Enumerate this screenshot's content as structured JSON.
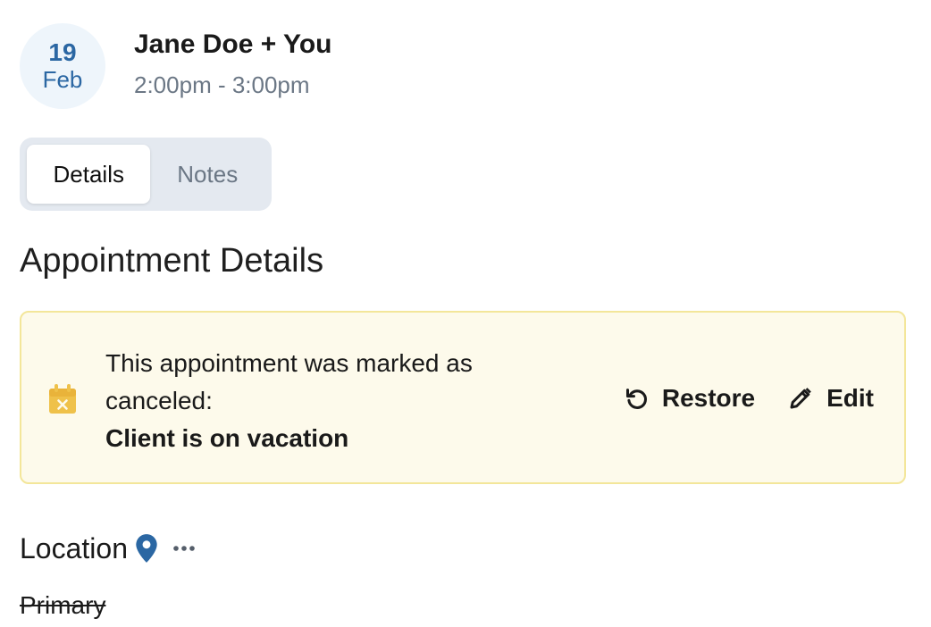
{
  "header": {
    "date_day": "19",
    "date_month": "Feb",
    "title": "Jane Doe + You",
    "time_range": "2:00pm - 3:00pm"
  },
  "tabs": [
    {
      "label": "Details",
      "active": true
    },
    {
      "label": "Notes",
      "active": false
    }
  ],
  "section_heading": "Appointment Details",
  "alert": {
    "icon": "calendar-x-icon",
    "message": "This appointment was marked as canceled:",
    "reason": "Client is on vacation",
    "restore_label": "Restore",
    "edit_label": "Edit"
  },
  "location": {
    "label": "Location",
    "value": "Primary",
    "value_struck_through": true
  },
  "colors": {
    "accent": "#2b67a3",
    "alert_bg": "#fdfaeb",
    "alert_border": "#f3e69a",
    "alert_icon": "#efc14a",
    "muted_text": "#6b7785",
    "tab_bar_bg": "#e4e9f0"
  }
}
